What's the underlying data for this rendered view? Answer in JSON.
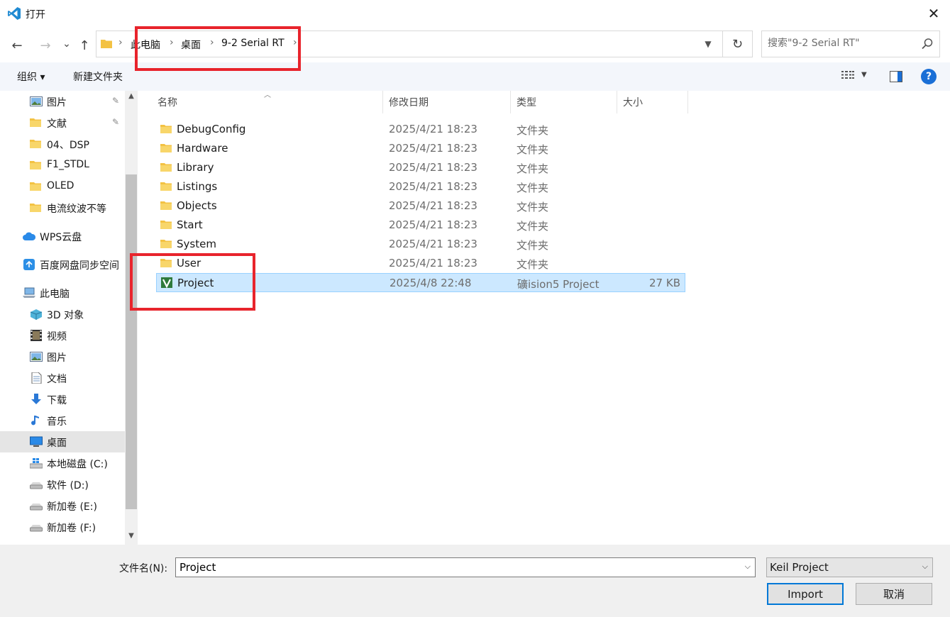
{
  "window": {
    "title": "打开",
    "close_glyph": "✕"
  },
  "nav": {
    "back": "←",
    "forward": "→",
    "recent": "⌄",
    "up": "↑",
    "refresh": "↻"
  },
  "address": {
    "crumbs": [
      "此电脑",
      "桌面",
      "9-2 Serial RT"
    ],
    "separator": "›"
  },
  "search": {
    "placeholder": "搜索\"9-2 Serial RT\""
  },
  "toolbar": {
    "organize": "组织 ▾",
    "new_folder": "新建文件夹",
    "view_dd": "▼",
    "help": "?"
  },
  "sidebar": {
    "items": [
      {
        "label": "图片",
        "icon": "pictures-icon",
        "pinned": true
      },
      {
        "label": "文献",
        "icon": "folder-icon",
        "pinned": true
      },
      {
        "label": "04、DSP",
        "icon": "folder-icon"
      },
      {
        "label": "F1_STDL",
        "icon": "folder-icon"
      },
      {
        "label": "OLED",
        "icon": "folder-icon"
      },
      {
        "label": "电流纹波不等",
        "icon": "folder-icon"
      },
      {
        "label": "WPS云盘",
        "icon": "cloud-icon"
      },
      {
        "label": "百度网盘同步空间",
        "icon": "baidu-sync-icon"
      },
      {
        "label": "此电脑",
        "icon": "computer-icon"
      },
      {
        "label": "3D 对象",
        "icon": "3d-objects-icon"
      },
      {
        "label": "视频",
        "icon": "videos-icon"
      },
      {
        "label": "图片",
        "icon": "pictures-icon"
      },
      {
        "label": "文档",
        "icon": "documents-icon"
      },
      {
        "label": "下载",
        "icon": "downloads-icon"
      },
      {
        "label": "音乐",
        "icon": "music-icon"
      },
      {
        "label": "桌面",
        "icon": "desktop-icon",
        "selected": true
      },
      {
        "label": "本地磁盘 (C:)",
        "icon": "system-drive-icon"
      },
      {
        "label": "软件 (D:)",
        "icon": "drive-icon"
      },
      {
        "label": "新加卷 (E:)",
        "icon": "drive-icon"
      },
      {
        "label": "新加卷 (F:)",
        "icon": "drive-icon"
      }
    ]
  },
  "columns": {
    "name": "名称",
    "date": "修改日期",
    "type": "类型",
    "size": "大小"
  },
  "files": [
    {
      "name": "DebugConfig",
      "date": "2025/4/21 18:23",
      "type": "文件夹",
      "size": "",
      "icon": "folder-icon"
    },
    {
      "name": "Hardware",
      "date": "2025/4/21 18:23",
      "type": "文件夹",
      "size": "",
      "icon": "folder-icon"
    },
    {
      "name": "Library",
      "date": "2025/4/21 18:23",
      "type": "文件夹",
      "size": "",
      "icon": "folder-icon"
    },
    {
      "name": "Listings",
      "date": "2025/4/21 18:23",
      "type": "文件夹",
      "size": "",
      "icon": "folder-icon"
    },
    {
      "name": "Objects",
      "date": "2025/4/21 18:23",
      "type": "文件夹",
      "size": "",
      "icon": "folder-icon"
    },
    {
      "name": "Start",
      "date": "2025/4/21 18:23",
      "type": "文件夹",
      "size": "",
      "icon": "folder-icon"
    },
    {
      "name": "System",
      "date": "2025/4/21 18:23",
      "type": "文件夹",
      "size": "",
      "icon": "folder-icon"
    },
    {
      "name": "User",
      "date": "2025/4/21 18:23",
      "type": "文件夹",
      "size": "",
      "icon": "folder-icon"
    },
    {
      "name": "Project",
      "date": "2025/4/8 22:48",
      "type": "礦ision5 Project",
      "size": "27 KB",
      "icon": "keil-uvision-icon",
      "selected": true
    }
  ],
  "bottom": {
    "filename_label": "文件名(N):",
    "filename_value": "Project",
    "filetype_value": "Keil Project",
    "import_label": "Import",
    "cancel_label": "取消",
    "dropdown_glyph": "⌵"
  },
  "colors": {
    "accent": "#0078d7",
    "selection": "#cce8ff",
    "highlight_box": "#e8242c",
    "folder": "#f3c243"
  }
}
